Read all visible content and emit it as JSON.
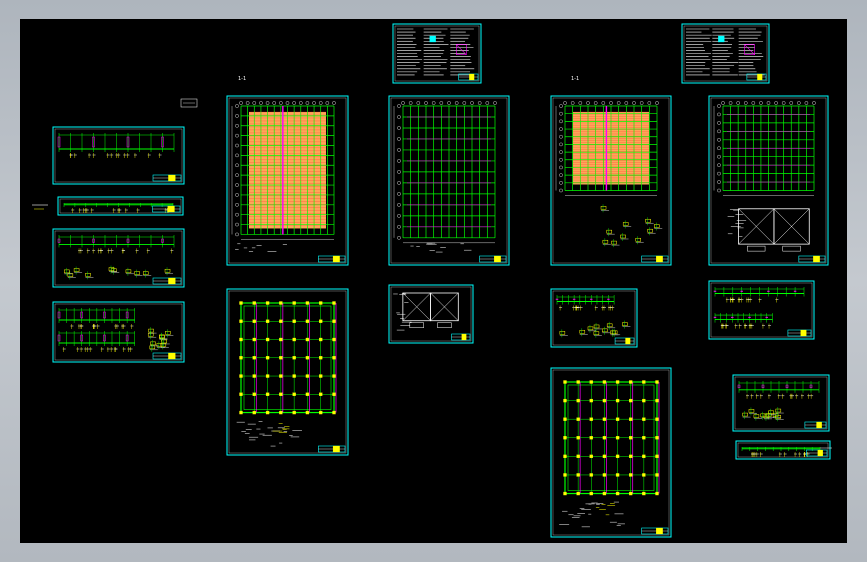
{
  "viewport": {
    "background": "#000000",
    "frame_color": "#b9bfc6",
    "section_marks": [
      "1-1",
      "1-1"
    ]
  },
  "colors": {
    "sheet_border": "#00ffff",
    "grid": "#00ff00",
    "slab_fill": "#ffff00",
    "rebar": "#ff00ff",
    "red": "#ff3030",
    "text": "#ffffff",
    "title_block": "#00ffff"
  },
  "sheets": [
    {
      "id": "elev-a",
      "kind": "elevation"
    },
    {
      "id": "elev-b",
      "kind": "elevation-strip"
    },
    {
      "id": "elev-c",
      "kind": "elevation-details"
    },
    {
      "id": "elev-d",
      "kind": "elevation-double"
    },
    {
      "id": "plan-1",
      "kind": "slab-plan-yellow"
    },
    {
      "id": "plan-2",
      "kind": "beam-plan"
    },
    {
      "id": "plan-3",
      "kind": "slab-plan-yellow-details"
    },
    {
      "id": "plan-4",
      "kind": "beam-plan-details"
    },
    {
      "id": "plan-5",
      "kind": "column-plan"
    },
    {
      "id": "plan-6",
      "kind": "column-plan"
    },
    {
      "id": "notes-1",
      "kind": "notes"
    },
    {
      "id": "notes-2",
      "kind": "notes"
    },
    {
      "id": "detail-1",
      "kind": "foundation-detail"
    },
    {
      "id": "detail-2",
      "kind": "elevation-small"
    },
    {
      "id": "elev-e",
      "kind": "elevation"
    },
    {
      "id": "elev-f",
      "kind": "elevation"
    },
    {
      "id": "elev-g",
      "kind": "elevation-strip"
    }
  ]
}
